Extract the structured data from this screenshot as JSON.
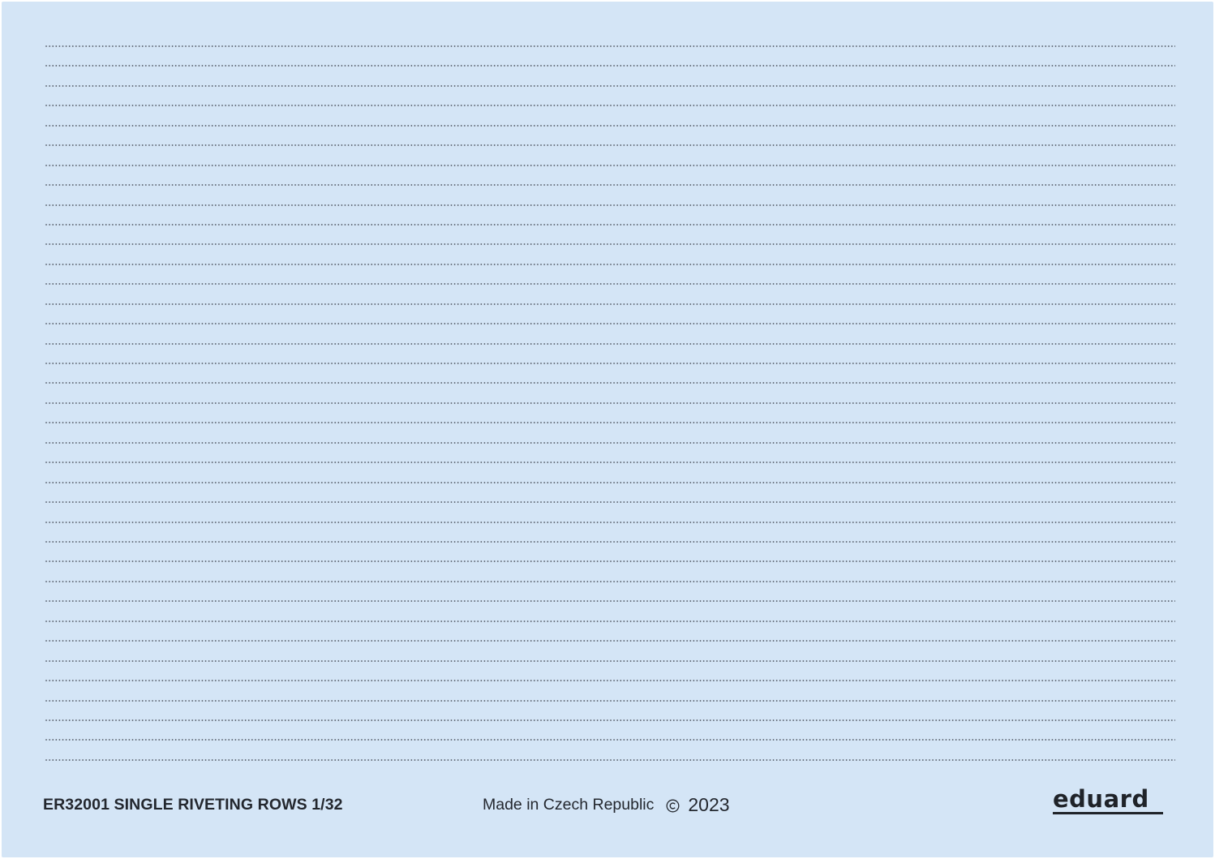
{
  "sheet": {
    "rivet_row_count": 37,
    "product_title": "ER32001 SINGLE RIVETING ROWS 1/32",
    "made_in": "Made in Czech Republic",
    "copyright_symbol": "©",
    "year": "2023",
    "brand": "eduard",
    "colors": {
      "background": "#d4e5f6",
      "rivet": "#5c6470",
      "text": "#23272e"
    }
  }
}
